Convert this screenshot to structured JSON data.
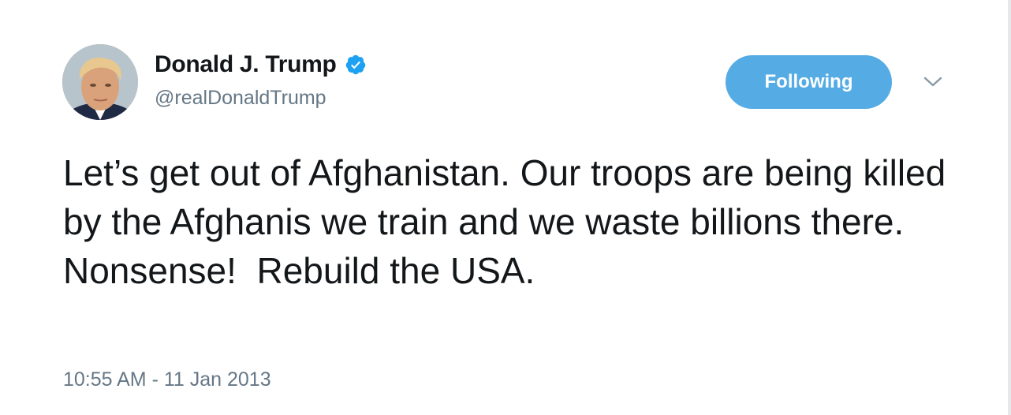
{
  "tweet": {
    "author": {
      "display_name": "Donald J. Trump",
      "handle": "@realDonaldTrump",
      "verified": true
    },
    "follow_button_label": "Following",
    "text": "Let’s get out of Afghanistan. Our troops are being killed by the Afghanis we train and we waste billions there. Nonsense!  Rebuild the USA.",
    "timestamp": "10:55 AM - 11 Jan 2013"
  },
  "colors": {
    "accent": "#55ace5",
    "text_primary": "#14171a",
    "text_secondary": "#657786",
    "verified_badge": "#1da1f2"
  },
  "icons": {
    "verified": "verified-badge-icon",
    "menu": "chevron-down-icon"
  }
}
